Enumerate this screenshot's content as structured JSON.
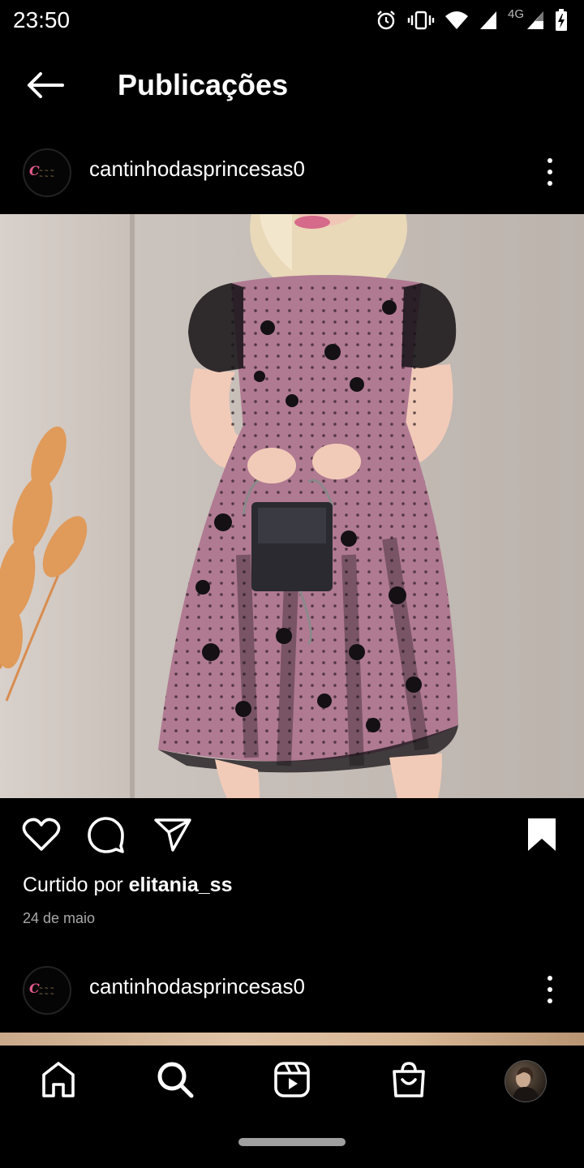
{
  "status_bar": {
    "time": "23:50",
    "network_label": "4G",
    "icons": [
      "alarm-icon",
      "vibrate-icon",
      "wifi-icon",
      "signal-icon",
      "signal-icon",
      "battery-charging-icon"
    ]
  },
  "top_bar": {
    "back_icon": "arrow-left-icon",
    "title": "Publicações"
  },
  "post": {
    "username": "cantinhodasprincesas0",
    "image_alt": "",
    "actions": [
      "heart-icon",
      "comment-icon",
      "send-icon",
      "bookmark-icon"
    ],
    "liked_by_prefix": "Curtido por ",
    "liked_by_user": "elitania_ss",
    "date": "24 de maio"
  },
  "next_post": {
    "username": "cantinhodasprincesas0"
  },
  "bottom_nav": {
    "items": [
      "home-icon",
      "search-icon",
      "reels-icon",
      "shop-icon",
      "profile-avatar"
    ]
  },
  "colors": {
    "background": "#000000",
    "text": "#ffffff",
    "secondary_text": "#a8a8a8",
    "dress_pink": "#b07a92",
    "lace_black": "#141014"
  }
}
